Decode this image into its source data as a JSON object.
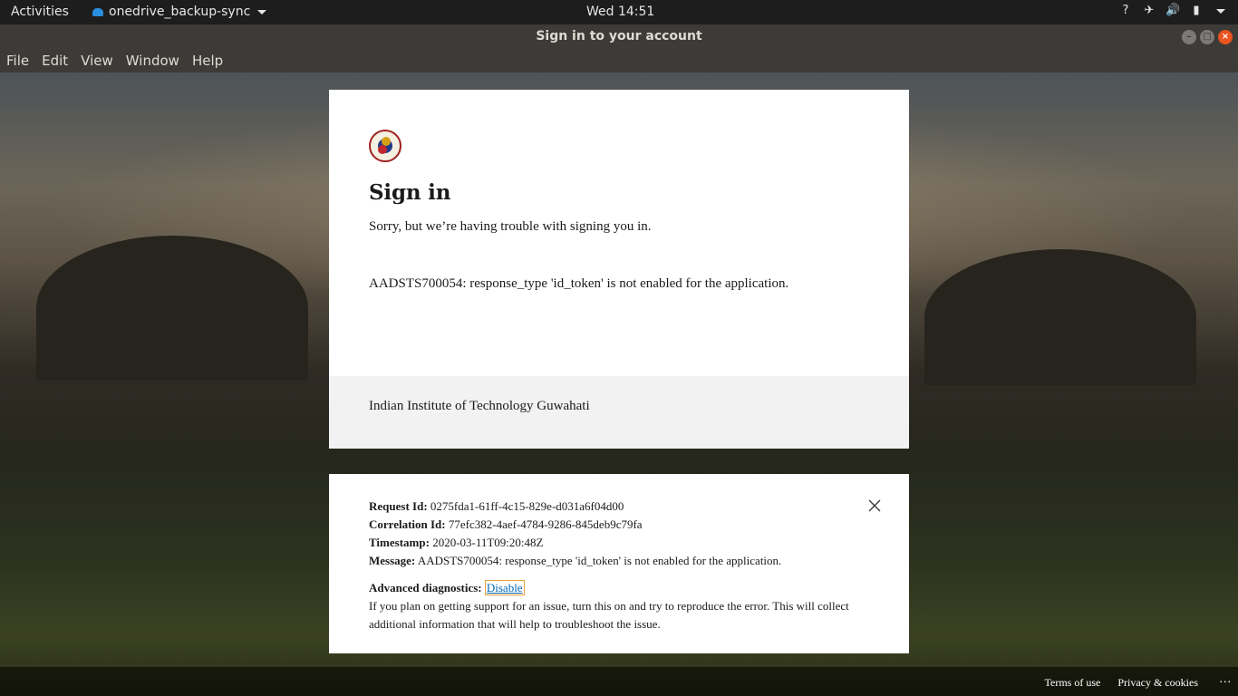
{
  "topbar": {
    "activities": "Activities",
    "app_name": "onedrive_backup-sync",
    "clock": "Wed 14:51",
    "tray_icons": [
      "network-question-icon",
      "airplane-icon",
      "volume-icon",
      "battery-icon",
      "system-menu-caret-icon"
    ]
  },
  "window": {
    "title": "Sign in to your account",
    "buttons": [
      "minimize",
      "maximize",
      "close"
    ]
  },
  "menu": {
    "items": [
      "File",
      "Edit",
      "View",
      "Window",
      "Help"
    ]
  },
  "signin": {
    "title": "Sign in",
    "subtitle": "Sorry, but we’re having trouble with signing you in.",
    "error": "AADSTS700054: response_type 'id_token' is not enabled for the application.",
    "organization": "Indian Institute of Technology Guwahati"
  },
  "diagnostics": {
    "request_id_label": "Request Id:",
    "request_id": "0275fda1-61ff-4c15-829e-d031a6f04d00",
    "correlation_id_label": "Correlation Id:",
    "correlation_id": "77efc382-4aef-4784-9286-845deb9c79fa",
    "timestamp_label": "Timestamp:",
    "timestamp": "2020-03-11T09:20:48Z",
    "message_label": "Message:",
    "message": "AADSTS700054: response_type 'id_token' is not enabled for the application.",
    "advanced_label": "Advanced diagnostics:",
    "advanced_link": "Disable",
    "help_text": "If you plan on getting support for an issue, turn this on and try to reproduce the error. This will collect additional information that will help to troubleshoot the issue."
  },
  "footer": {
    "terms": "Terms of use",
    "privacy": "Privacy & cookies",
    "more": "..."
  },
  "colors": {
    "link": "#0067b8",
    "close_button": "#e95420",
    "titlebar": "#3c3b37"
  }
}
